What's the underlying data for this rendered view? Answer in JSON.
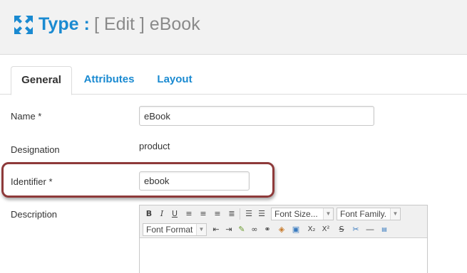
{
  "header": {
    "title": "Type :",
    "subtitle": "[ Edit ] eBook",
    "icon": "expand-arrows-icon",
    "accent_color": "#1a8ad1"
  },
  "tabs": [
    {
      "label": "General",
      "active": true
    },
    {
      "label": "Attributes",
      "active": false
    },
    {
      "label": "Layout",
      "active": false
    }
  ],
  "form": {
    "name_label": "Name *",
    "name_value": "eBook",
    "designation_label": "Designation",
    "designation_value": "product",
    "identifier_label": "Identifier *",
    "identifier_value": "ebook",
    "description_label": "Description"
  },
  "editor": {
    "font_size_label": "Font Size...",
    "font_family_label": "Font Family.",
    "font_format_label": "Font Format",
    "buttons": {
      "bold": "B",
      "italic": "I",
      "subscript": "X₂",
      "superscript": "X²",
      "strike": "S"
    }
  },
  "highlight_color": "#8e3a3a"
}
